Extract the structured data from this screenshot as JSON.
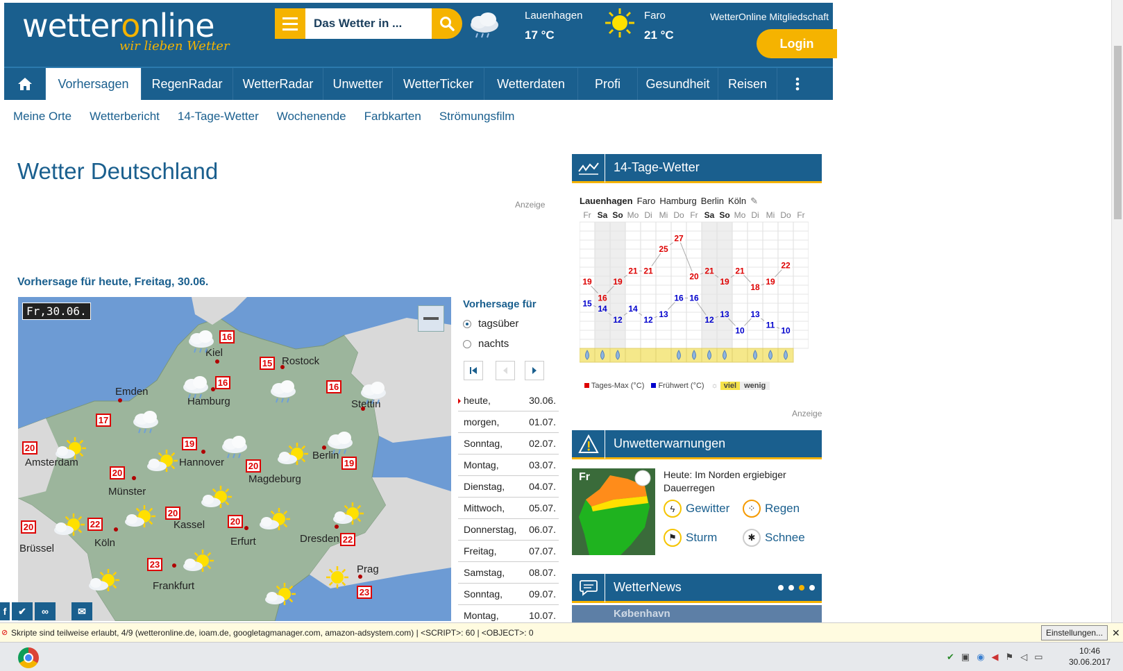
{
  "header": {
    "logo_main_pre": "wetter",
    "logo_main_o": "o",
    "logo_main_post": "nline",
    "logo_sub": "wir lieben Wetter",
    "search_placeholder": "Das Wetter in ...",
    "weather1_city": "Lauenhagen",
    "weather1_temp": "17 °C",
    "weather2_city": "Faro",
    "weather2_temp": "21 °C",
    "member_text": "WetterOnline Mitgliedschaft",
    "login_label": "Login"
  },
  "nav": [
    {
      "label": "Vorhersagen",
      "active": true
    },
    {
      "label": "RegenRadar"
    },
    {
      "label": "WetterRadar"
    },
    {
      "label": "Unwetter"
    },
    {
      "label": "WetterTicker"
    },
    {
      "label": "Wetterdaten"
    },
    {
      "label": "Profi"
    },
    {
      "label": "Gesundheit"
    },
    {
      "label": "Reisen"
    }
  ],
  "subnav": [
    "Meine Orte",
    "Wetterbericht",
    "14-Tage-Wetter",
    "Wochenende",
    "Farbkarten",
    "Strömungsfilm"
  ],
  "main": {
    "title": "Wetter Deutschland",
    "anzeige": "Anzeige",
    "forecast_title": "Vorhersage für heute, Freitag, 30.06."
  },
  "map": {
    "date": "Fr,30.06.",
    "cities": [
      "Kiel",
      "Rostock",
      "Emden",
      "Hamburg",
      "Stettin",
      "Amsterdam",
      "Hannover",
      "Berlin",
      "Münster",
      "Magdeburg",
      "Kassel",
      "Erfurt",
      "Dresden",
      "Köln",
      "Brüssel",
      "Frankfurt",
      "Prag"
    ],
    "temps": [
      "16",
      "15",
      "16",
      "16",
      "17",
      "20",
      "19",
      "19",
      "20",
      "20",
      "20",
      "20",
      "22",
      "22",
      "20",
      "23",
      "23"
    ]
  },
  "forecast_panel": {
    "heading": "Vorhersage für",
    "option_day": "tagsüber",
    "option_night": "nachts",
    "days": [
      {
        "name": "heute,",
        "date": "30.06."
      },
      {
        "name": "morgen,",
        "date": "01.07."
      },
      {
        "name": "Sonntag,",
        "date": "02.07."
      },
      {
        "name": "Montag,",
        "date": "03.07."
      },
      {
        "name": "Dienstag,",
        "date": "04.07."
      },
      {
        "name": "Mittwoch,",
        "date": "05.07."
      },
      {
        "name": "Donnerstag,",
        "date": "06.07."
      },
      {
        "name": "Freitag,",
        "date": "07.07."
      },
      {
        "name": "Samstag,",
        "date": "08.07."
      },
      {
        "name": "Sonntag,",
        "date": "09.07."
      },
      {
        "name": "Montag,",
        "date": "10.07."
      }
    ]
  },
  "tage14": {
    "heading": "14-Tage-Wetter",
    "cities": [
      "Lauenhagen",
      "Faro",
      "Hamburg",
      "Berlin",
      "Köln"
    ],
    "anzeige": "Anzeige",
    "legend_max": "Tages-Max (°C)",
    "legend_min": "Frühwert (°C)",
    "legend_viel": "viel",
    "legend_wenig": "wenig"
  },
  "chart_data": {
    "type": "line",
    "categories": [
      "Fr",
      "Sa",
      "So",
      "Mo",
      "Di",
      "Mi",
      "Do",
      "Fr",
      "Sa",
      "So",
      "Mo",
      "Di",
      "Mi",
      "Do",
      "Fr"
    ],
    "series": [
      {
        "name": "Tages-Max (°C)",
        "values": [
          19,
          16,
          19,
          21,
          21,
          25,
          27,
          20,
          21,
          19,
          21,
          18,
          19,
          22,
          null
        ],
        "color": "#dd0000"
      },
      {
        "name": "Frühwert (°C)",
        "values": [
          15,
          14,
          12,
          14,
          12,
          13,
          16,
          16,
          12,
          13,
          10,
          13,
          11,
          10,
          null
        ],
        "color": "#0000cc"
      }
    ],
    "ylim": [
      8,
      29
    ]
  },
  "unwetter": {
    "heading": "Unwetterwarnungen",
    "map_label": "Fr",
    "text": "Heute: Im Norden ergiebiger Dauerregen",
    "items": [
      "Gewitter",
      "Regen",
      "Sturm",
      "Schnee"
    ]
  },
  "news": {
    "heading": "WetterNews",
    "city": "København"
  },
  "noscript": {
    "text": "Skripte sind teilweise erlaubt, 4/9 (wetteronline.de, ioam.de, googletagmanager.com, amazon-adsystem.com) | <SCRIPT>: 60 | <OBJECT>: 0",
    "settings": "Einstellungen..."
  },
  "taskbar": {
    "time": "10:46",
    "date": "30.06.2017"
  }
}
